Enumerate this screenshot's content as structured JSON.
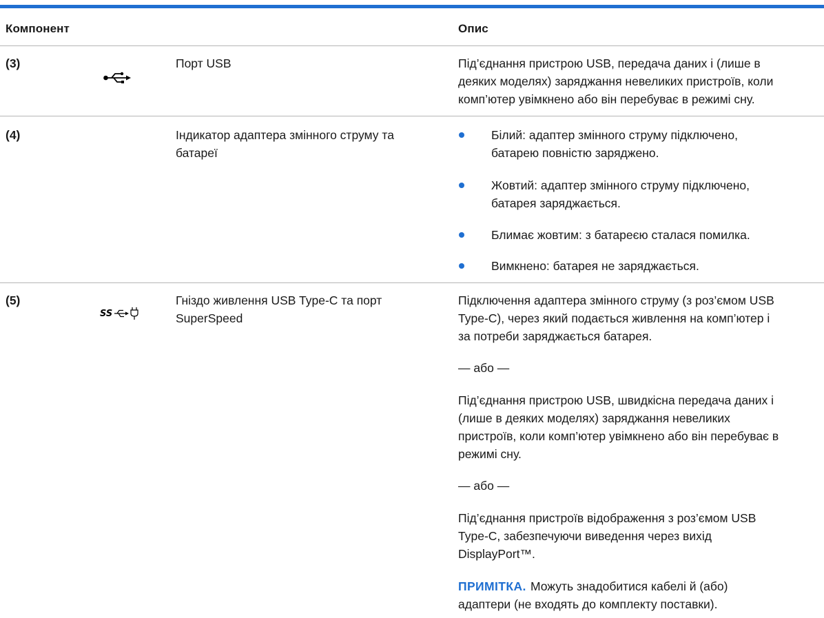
{
  "header": {
    "component": "Компонент",
    "description": "Опис"
  },
  "rows": [
    {
      "num": "(3)",
      "icon": "usb-icon",
      "name": [
        "Порт USB"
      ],
      "desc": [
        "Під’єднання пристрою USB, передача даних і (лише в",
        "деяких моделях) заряджання невеликих пристроїв, коли",
        "комп’ютер увімкнено або він перебуває в режимі сну."
      ]
    },
    {
      "num": "(4)",
      "icon": "",
      "name": [
        "Індикатор адаптера змінного струму та",
        "батареї"
      ],
      "bullets": [
        [
          "Білий: адаптер змінного струму підключено,",
          "батарею повністю заряджено."
        ],
        [
          "Жовтий: адаптер змінного струму підключено,",
          "батарея заряджається."
        ],
        [
          "Блимає жовтим: з батареєю сталася помилка."
        ],
        [
          "Вимкнено: батарея не заряджається."
        ]
      ]
    },
    {
      "num": "(5)",
      "icon": "usb-superspeed-power-icon",
      "name": [
        "Гніздо живлення USB Type-C та порт",
        "SuperSpeed"
      ],
      "para1": [
        "Підключення адаптера змінного струму (з роз’ємом USB",
        "Type-C), через який подається живлення на комп’ютер і",
        "за потреби заряджається батарея."
      ],
      "or1": "— або —",
      "para2": [
        "Під’єднання пристрою USB, швидкісна передача даних і",
        "(лише в деяких моделях) заряджання невеликих",
        "пристроїв, коли комп’ютер увімкнено або він перебуває в",
        "режимі сну."
      ],
      "or2": "— або —",
      "para3": [
        "Під’єднання пристроїв відображення з роз’ємом USB",
        "Type-C, забезпечуючи виведення через вихід",
        "DisplayPort™."
      ],
      "note_label": "ПРИМІТКА.",
      "note": [
        "Можуть знадобитися кабелі й (або)",
        "адаптери (не входять до комплекту поставки)."
      ]
    }
  ]
}
